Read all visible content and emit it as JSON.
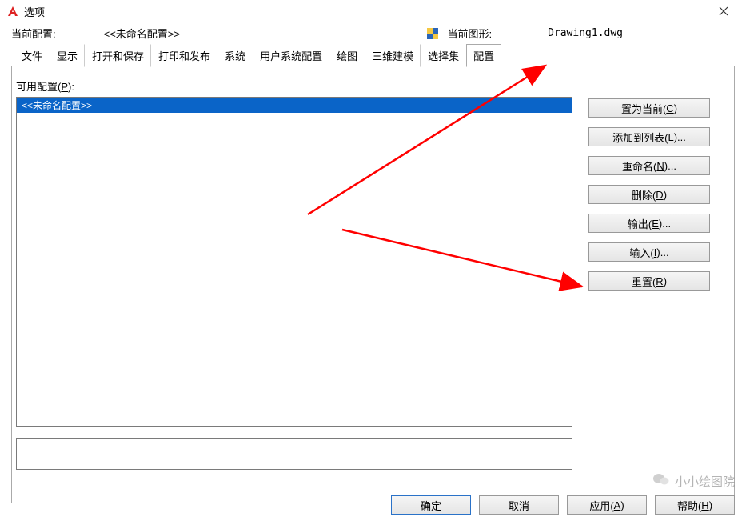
{
  "title": "选项",
  "info": {
    "current_config_label": "当前配置:",
    "current_config_value": "<<未命名配置>>",
    "current_drawing_label": "当前图形:",
    "current_drawing_value": "Drawing1.dwg"
  },
  "tabs": [
    "文件",
    "显示",
    "打开和保存",
    "打印和发布",
    "系统",
    "用户系统配置",
    "绘图",
    "三维建模",
    "选择集",
    "配置"
  ],
  "active_tab": "配置",
  "available_label": "可用配置(P):",
  "list_items": [
    "<<未命名配置>>"
  ],
  "buttons": {
    "set_current": "置为当前(C)",
    "add_to_list": "添加到列表(L)...",
    "rename": "重命名(N)...",
    "delete": "删除(D)",
    "export": "输出(E)...",
    "import": "输入(I)...",
    "reset": "重置(R)"
  },
  "bottom_buttons": {
    "ok": "确定",
    "cancel": "取消",
    "apply": "应用(A)",
    "help": "帮助(H)"
  },
  "watermark": "小小绘图院"
}
